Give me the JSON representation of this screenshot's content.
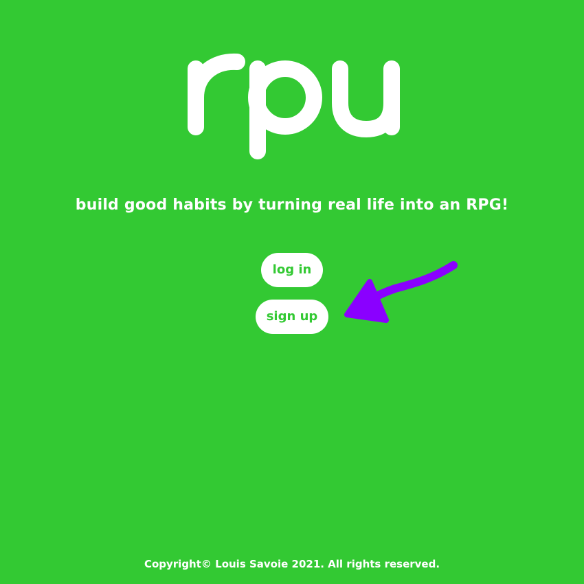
{
  "brand": {
    "logo_text": "rpu"
  },
  "hero": {
    "tagline": "build good habits by turning real life into an RPG!"
  },
  "auth": {
    "login_label": "log in",
    "signup_label": "sign up"
  },
  "footer": {
    "copyright": "Copyright© Louis Savoie 2021. All rights reserved."
  },
  "colors": {
    "background": "#33c933",
    "text": "#ffffff",
    "button_text": "#33c933",
    "arrow": "#8a00ff"
  },
  "annotations": {
    "arrow_icon": "hand-drawn-arrow-icon"
  }
}
